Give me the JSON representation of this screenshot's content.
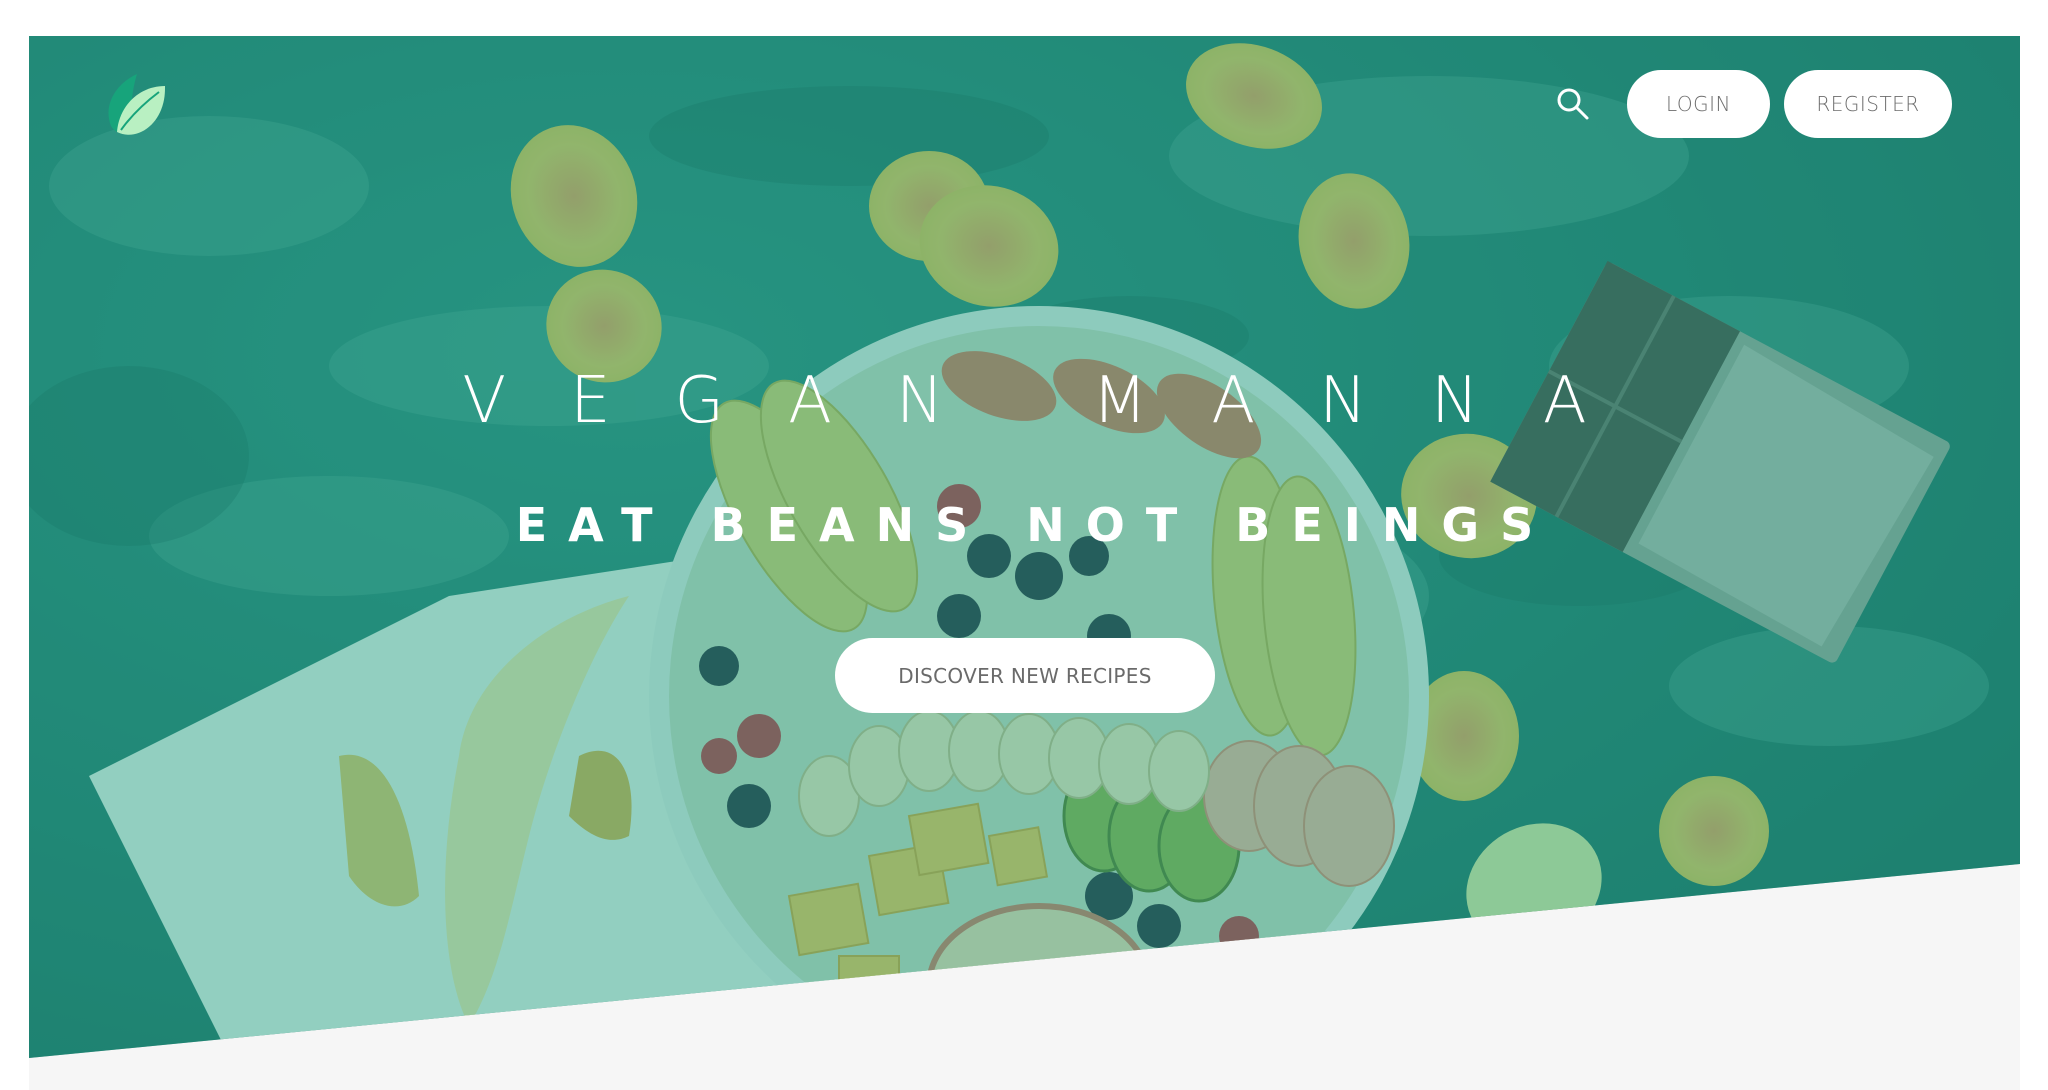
{
  "brand": {
    "logo_icon": "leaf-icon",
    "accent": "#3fb58f",
    "overlay": "#1d9a82"
  },
  "header": {
    "search_icon": "search-icon",
    "login_label": "LOGIN",
    "register_label": "REGISTER"
  },
  "hero": {
    "title": "VEGAN MANNA",
    "subtitle": "EAT BEANS NOT BEINGS",
    "cta_label": "DISCOVER NEW RECIPES"
  }
}
